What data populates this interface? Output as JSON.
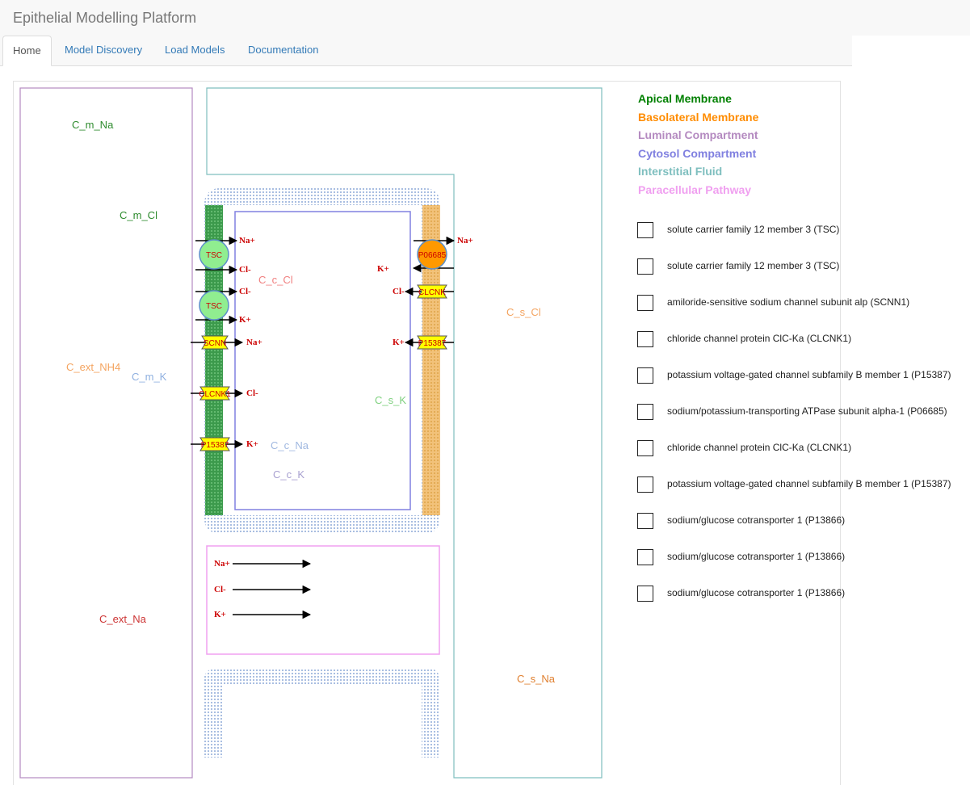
{
  "app": {
    "title": "Epithelial Modelling Platform"
  },
  "tabs": [
    {
      "label": "Home",
      "active": true
    },
    {
      "label": "Model Discovery",
      "active": false
    },
    {
      "label": "Load Models",
      "active": false
    },
    {
      "label": "Documentation",
      "active": false
    }
  ],
  "legend": [
    {
      "label": "Apical Membrane",
      "color": "#008000"
    },
    {
      "label": "Basolateral Membrane",
      "color": "#ff8c00"
    },
    {
      "label": "Luminal Compartment",
      "color": "#b48ac0"
    },
    {
      "label": "Cytosol Compartment",
      "color": "#8080e0"
    },
    {
      "label": "Interstitial Fluid",
      "color": "#7fbfbf"
    },
    {
      "label": "Paracellular Pathway",
      "color": "#f0a0f0"
    }
  ],
  "concentrations": {
    "c_m_na": "C_m_Na",
    "c_m_cl": "C_m_Cl",
    "c_ext_nh4": "C_ext_NH4",
    "c_m_k": "C_m_K",
    "c_ext_na": "C_ext_Na",
    "c_c_cl": "C_c_Cl",
    "c_c_na": "C_c_Na",
    "c_c_k": "C_c_K",
    "c_s_cl": "C_s_Cl",
    "c_s_k": "C_s_K",
    "c_s_na": "C_s_Na"
  },
  "ions": {
    "na": "Na+",
    "cl": "Cl-",
    "k": "K+"
  },
  "transporters": {
    "tsc": "TSC",
    "p06685": "P06685",
    "clcnk": "CLCNK",
    "scnn": "SCNN",
    "clcnk1": "CLCNK1",
    "p15387": "P15387"
  },
  "models": [
    {
      "label": "solute carrier family 12 member 3 (TSC)",
      "checked": false
    },
    {
      "label": "solute carrier family 12 member 3 (TSC)",
      "checked": false
    },
    {
      "label": "amiloride-sensitive sodium channel subunit alp (SCNN1)",
      "checked": false
    },
    {
      "label": "chloride channel protein ClC-Ka (CLCNK1)",
      "checked": false
    },
    {
      "label": "potassium voltage-gated channel subfamily B member 1 (P15387)",
      "checked": false
    },
    {
      "label": "sodium/potassium-transporting ATPase subunit alpha-1 (P06685)",
      "checked": false
    },
    {
      "label": "chloride channel protein ClC-Ka (CLCNK1)",
      "checked": false
    },
    {
      "label": "potassium voltage-gated channel subfamily B member 1 (P15387)",
      "checked": false
    },
    {
      "label": "sodium/glucose cotransporter 1 (P13866)",
      "checked": false
    },
    {
      "label": "sodium/glucose cotransporter 1 (P13866)",
      "checked": false
    },
    {
      "label": "sodium/glucose cotransporter 1 (P13866)",
      "checked": false
    }
  ]
}
